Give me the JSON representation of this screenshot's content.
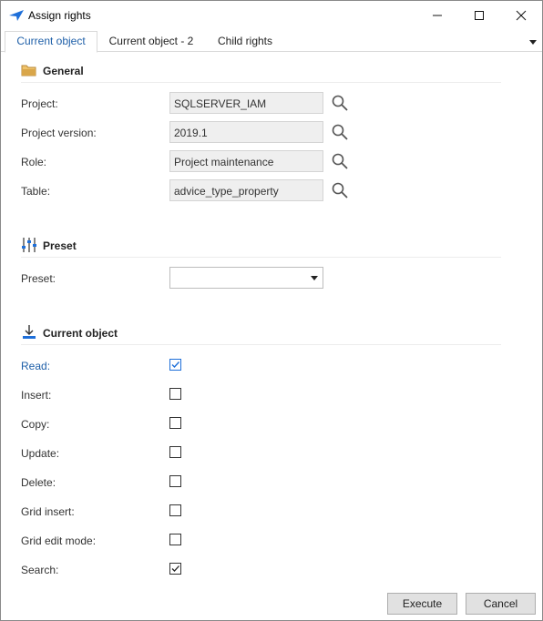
{
  "window": {
    "title": "Assign rights"
  },
  "tabs": [
    {
      "label": "Current object",
      "active": true
    },
    {
      "label": "Current object - 2",
      "active": false
    },
    {
      "label": "Child rights",
      "active": false
    }
  ],
  "general": {
    "title": "General",
    "fields": [
      {
        "label": "Project:",
        "value": "SQLSERVER_IAM"
      },
      {
        "label": "Project version:",
        "value": "2019.1"
      },
      {
        "label": "Role:",
        "value": "Project maintenance"
      },
      {
        "label": "Table:",
        "value": "advice_type_property"
      }
    ]
  },
  "preset": {
    "title": "Preset",
    "label": "Preset:",
    "value": ""
  },
  "current_object": {
    "title": "Current object",
    "rights": [
      {
        "label": "Read:",
        "checked": true
      },
      {
        "label": "Insert:",
        "checked": false
      },
      {
        "label": "Copy:",
        "checked": false
      },
      {
        "label": "Update:",
        "checked": false
      },
      {
        "label": "Delete:",
        "checked": false
      },
      {
        "label": "Grid insert:",
        "checked": false
      },
      {
        "label": "Grid edit mode:",
        "checked": false
      },
      {
        "label": "Search:",
        "checked": true
      }
    ]
  },
  "buttons": {
    "execute": "Execute",
    "cancel": "Cancel"
  },
  "colors": {
    "accent": "#1e5fa8",
    "read_check": "#1e6fd9",
    "field_bg": "#efefef"
  },
  "icons": [
    "app-arrow-icon",
    "minimize-icon",
    "maximize-icon",
    "close-icon",
    "folder-icon",
    "sliders-icon",
    "download-icon",
    "search-icon",
    "chevron-down-icon",
    "checkmark-icon"
  ]
}
